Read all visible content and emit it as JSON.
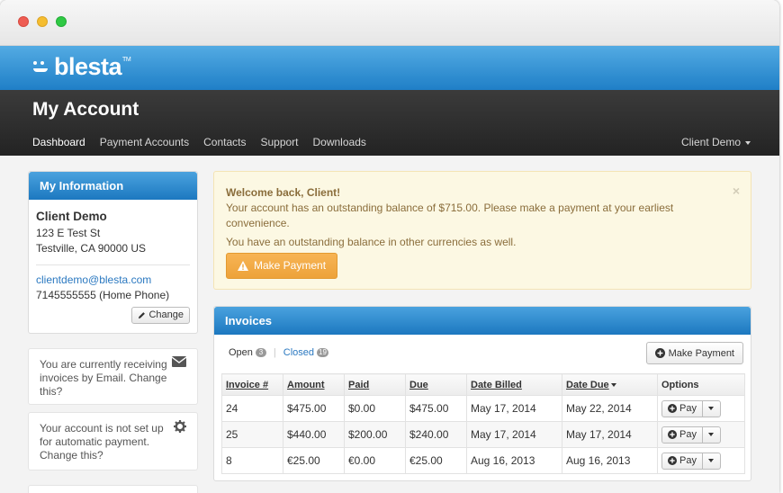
{
  "brand": {
    "logo_text": "blesta",
    "tm": "TM"
  },
  "header": {
    "title": "My Account",
    "nav": [
      "Dashboard",
      "Payment Accounts",
      "Contacts",
      "Support",
      "Downloads"
    ],
    "user": "Client Demo"
  },
  "info": {
    "heading": "My Information",
    "name": "Client Demo",
    "address1": "123 E Test St",
    "address2": "Testville, CA 90000 US",
    "email": "clientdemo@blesta.com",
    "phone": "7145555555 (Home Phone)",
    "change_label": "Change"
  },
  "notices": {
    "email_invoices": "You are currently receiving invoices by Email. Change this?",
    "autopay": "Your account is not set up for automatic payment. Change this?"
  },
  "alert": {
    "title": "Welcome back, Client!",
    "line1": "Your account has an outstanding balance of $715.00. Please make a payment at your earliest convenience.",
    "line2": "You have an outstanding balance in other currencies as well.",
    "button": "Make Payment",
    "close": "×"
  },
  "invoices": {
    "heading": "Invoices",
    "tabs": {
      "open_label": "Open",
      "open_count": "3",
      "closed_label": "Closed",
      "closed_count": "19"
    },
    "make_payment": "Make Payment",
    "columns": [
      "Invoice #",
      "Amount",
      "Paid",
      "Due",
      "Date Billed",
      "Date Due",
      "Options"
    ],
    "rows": [
      {
        "invoice": "24",
        "amount": "$475.00",
        "paid": "$0.00",
        "due": "$475.00",
        "billed": "May 17, 2014",
        "date_due": "May 22, 2014"
      },
      {
        "invoice": "25",
        "amount": "$440.00",
        "paid": "$200.00",
        "due": "$240.00",
        "billed": "May 17, 2014",
        "date_due": "May 17, 2014"
      },
      {
        "invoice": "8",
        "amount": "€25.00",
        "paid": "€0.00",
        "due": "€25.00",
        "billed": "Aug 16, 2013",
        "date_due": "Aug 16, 2013"
      }
    ],
    "pay_label": "Pay"
  },
  "colors": {
    "brand_blue": "#1f7fc7",
    "warning": "#eda23a",
    "link": "#2a78c0"
  },
  "icons": [
    "envelope-icon",
    "gear-icon",
    "pencil-icon",
    "warning-icon",
    "plus-circle-icon",
    "close-icon"
  ]
}
